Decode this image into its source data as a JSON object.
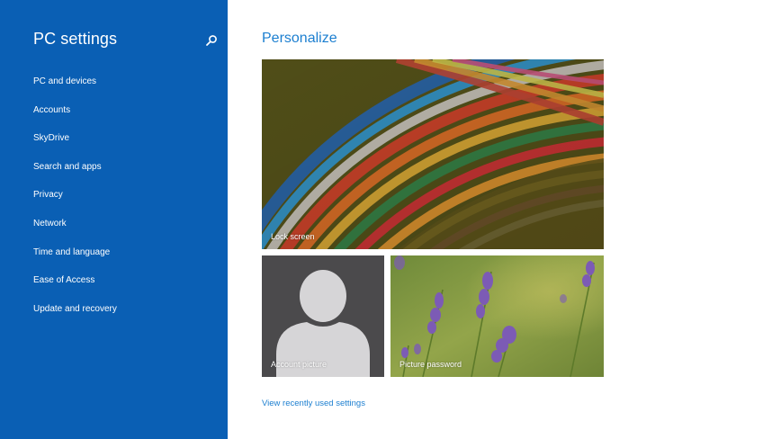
{
  "sidebar": {
    "title": "PC settings",
    "search_icon": "search-icon",
    "items": [
      {
        "label": "PC and devices"
      },
      {
        "label": "Accounts"
      },
      {
        "label": "SkyDrive"
      },
      {
        "label": "Search and apps"
      },
      {
        "label": "Privacy"
      },
      {
        "label": "Network"
      },
      {
        "label": "Time and language"
      },
      {
        "label": "Ease of Access"
      },
      {
        "label": "Update and recovery"
      }
    ]
  },
  "main": {
    "title": "Personalize",
    "tiles": {
      "lock_screen": {
        "label": "Lock screen"
      },
      "account_picture": {
        "label": "Account picture",
        "icon": "user-silhouette-icon"
      },
      "picture_password": {
        "label": "Picture password"
      }
    },
    "recent_link": "View recently used settings"
  },
  "colors": {
    "sidebar_bg": "#0a5fb4",
    "accent": "#1c7fd0",
    "account_tile_bg": "#4b4a4c"
  }
}
